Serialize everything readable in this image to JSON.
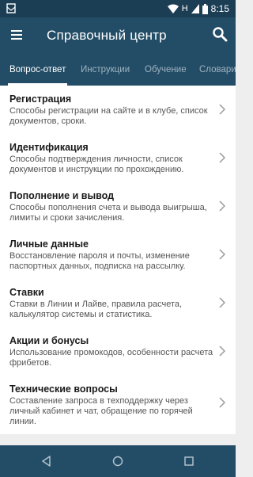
{
  "status_bar": {
    "network": "H",
    "time": "8:15"
  },
  "app_bar": {
    "title": "Справочный центр"
  },
  "tabs": [
    {
      "label": "Вопрос-ответ",
      "active": true
    },
    {
      "label": "Инструкции",
      "active": false
    },
    {
      "label": "Обучение",
      "active": false
    },
    {
      "label": "Словари",
      "active": false
    }
  ],
  "items": [
    {
      "title": "Регистрация",
      "desc": "Способы регистрации на сайте и в клубе, список документов, сроки."
    },
    {
      "title": "Идентификация",
      "desc": "Способы подтверждения личности, список документов и инструкции по прохождению."
    },
    {
      "title": "Пополнение и вывод",
      "desc": "Способы пополнения счета и вывода выигрыша, лимиты и сроки зачисления."
    },
    {
      "title": "Личные данные",
      "desc": "Восстановление пароля и почты, изменение паспортных данных, подписка на рассылку."
    },
    {
      "title": "Ставки",
      "desc": "Ставки в Линии и Лайве, правила расчета, калькулятор системы и статистика."
    },
    {
      "title": "Акции и бонусы",
      "desc": "Использование промокодов, особенности расчета фрибетов."
    },
    {
      "title": "Технические вопросы",
      "desc": "Составление запроса в техподдержку через личный кабинет и чат, обращение по горячей линии."
    }
  ],
  "colors": {
    "primary": "#234d67",
    "status_bar": "#1c3e54",
    "background": "#eeeeee"
  },
  "icons": [
    "mail-icon",
    "wifi-icon",
    "signal-icon",
    "battery-icon",
    "menu-icon",
    "search-icon",
    "chevron-right-icon",
    "back-icon",
    "home-icon",
    "recents-icon"
  ]
}
